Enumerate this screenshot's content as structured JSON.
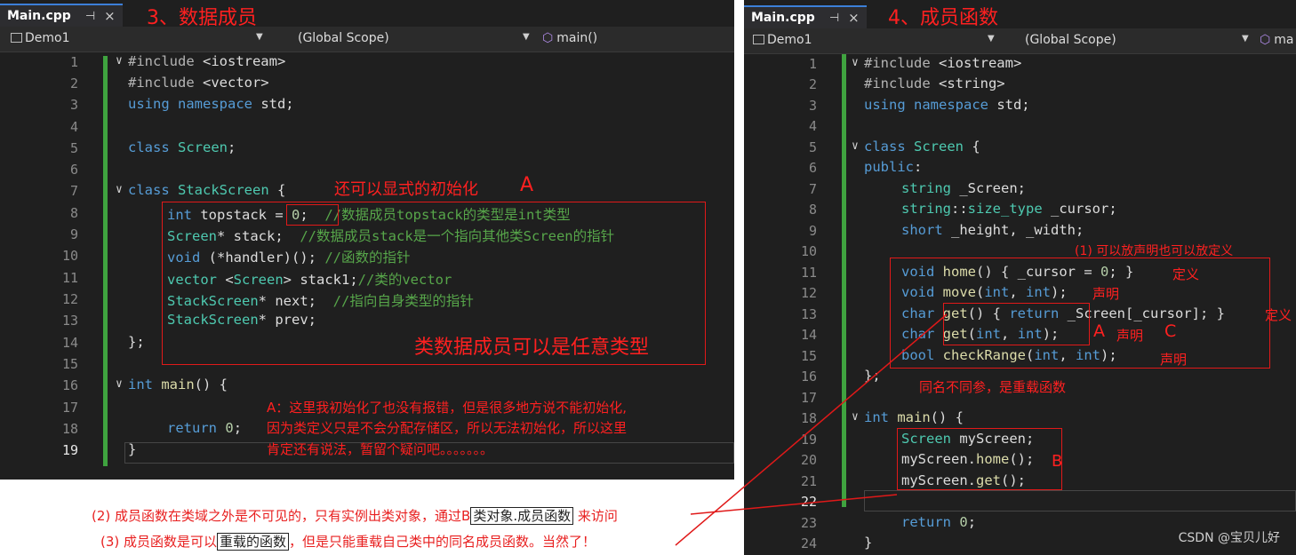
{
  "left": {
    "tab_label": "Main.cpp",
    "pin_glyph": "⊣",
    "close_glyph": "×",
    "heading": "3、数据成员",
    "project": "Demo1",
    "scope": "(Global Scope)",
    "member": "main()",
    "lines": [
      {
        "n": "1"
      },
      {
        "n": "2"
      },
      {
        "n": "3"
      },
      {
        "n": "4"
      },
      {
        "n": "5"
      },
      {
        "n": "6"
      },
      {
        "n": "7"
      },
      {
        "n": "8"
      },
      {
        "n": "9"
      },
      {
        "n": "10"
      },
      {
        "n": "11"
      },
      {
        "n": "12"
      },
      {
        "n": "13"
      },
      {
        "n": "14"
      },
      {
        "n": "15"
      },
      {
        "n": "16"
      },
      {
        "n": "17"
      },
      {
        "n": "18"
      },
      {
        "n": "19"
      }
    ],
    "annotations": {
      "init_note": "还可以显式的初始化",
      "init_letter": "A",
      "types_note": "类数据成员可以是任意类型",
      "a_note_1": "A：这里我初始化了也没有报错，但是很多地方说不能初始化,",
      "a_note_2": "因为类定义只是不会分配存储区，所以无法初始化，所以这里",
      "a_note_3": "肯定还有说法，暂留个疑问吧。。。。。。。"
    }
  },
  "right": {
    "tab_label": "Main.cpp",
    "pin_glyph": "⊣",
    "close_glyph": "×",
    "heading": "4、成员函数",
    "project": "Demo1",
    "scope": "(Global Scope)",
    "member": "ma",
    "lines": [
      {
        "n": "1"
      },
      {
        "n": "2"
      },
      {
        "n": "3"
      },
      {
        "n": "4"
      },
      {
        "n": "5"
      },
      {
        "n": "6"
      },
      {
        "n": "7"
      },
      {
        "n": "8"
      },
      {
        "n": "9"
      },
      {
        "n": "10"
      },
      {
        "n": "11"
      },
      {
        "n": "12"
      },
      {
        "n": "13"
      },
      {
        "n": "14"
      },
      {
        "n": "15"
      },
      {
        "n": "16"
      },
      {
        "n": "17"
      },
      {
        "n": "18"
      },
      {
        "n": "19"
      },
      {
        "n": "20"
      },
      {
        "n": "21"
      },
      {
        "n": "22"
      },
      {
        "n": "23"
      },
      {
        "n": "24"
      }
    ],
    "annotations": {
      "decl_def_note": "(1) 可以放声明也可以放定义",
      "def_1": "定义",
      "decl_1": "声明",
      "def_2": "定义",
      "decl_2": "声明",
      "decl_3": "声明",
      "letter_a": "A",
      "letter_c": "C",
      "letter_b": "B",
      "overload_note": "同名不同参，是重载函数"
    }
  },
  "bottom": {
    "note2_prefix": "(2) 成员函数在类域之外是不可见的，只有实例出类对象，通过B",
    "note2_boxed": "类对象.成员函数",
    "note2_suffix": "来访问",
    "note3_prefix": "(3) 成员函数是可以",
    "note3_boxed": "重载的函数",
    "note3_suffix": "，但是只能重载自己类中的同名成员函数。当然了！"
  },
  "watermark": "CSDN @宝贝儿好",
  "colors": {
    "editor_bg": "#1f1f1f",
    "keyword": "#569cd6",
    "type": "#4ec9b0",
    "function": "#dcdcaa",
    "comment": "#57a64a",
    "annotation": "#ff2020",
    "git_bar": "#3fa33f"
  }
}
